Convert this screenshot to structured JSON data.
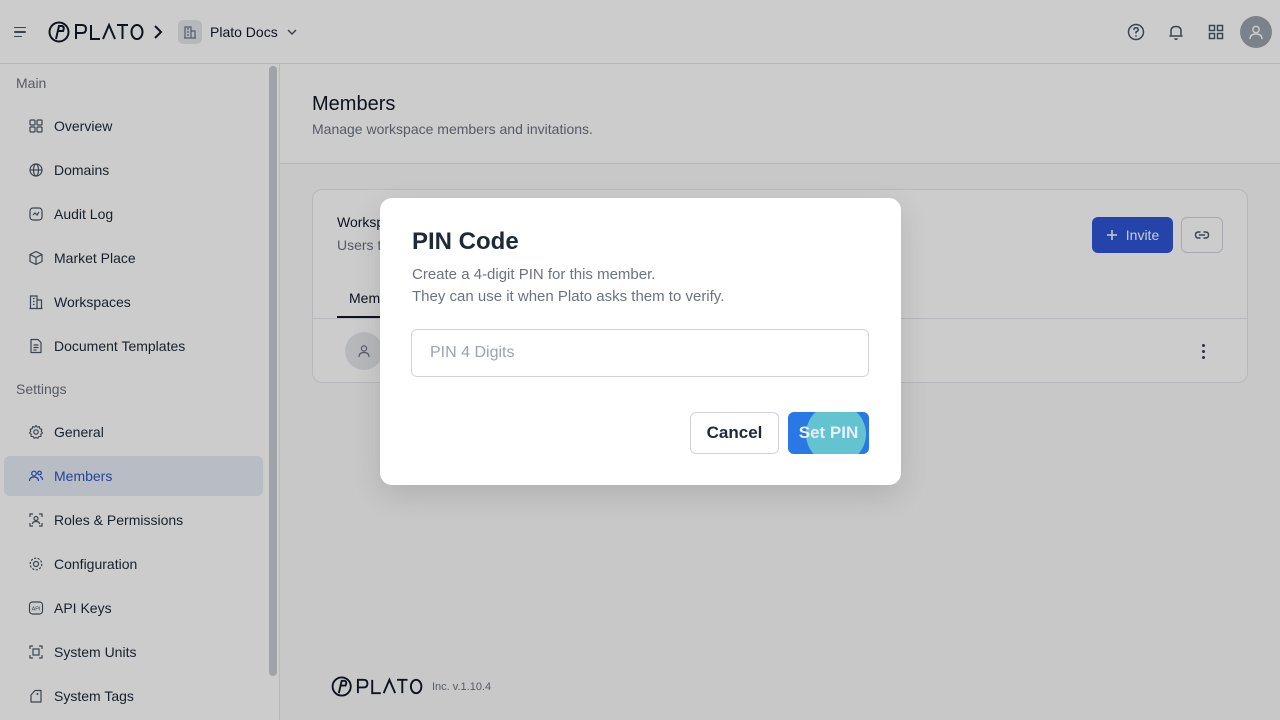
{
  "topbar": {
    "workspace_name": "Plato Docs"
  },
  "sidebar": {
    "sections": [
      {
        "label": "Main"
      },
      {
        "label": "Settings"
      }
    ],
    "items": [
      {
        "label": "Overview",
        "icon": "overview-icon"
      },
      {
        "label": "Domains",
        "icon": "globe-icon"
      },
      {
        "label": "Audit Log",
        "icon": "audit-log-icon"
      },
      {
        "label": "Market Place",
        "icon": "package-icon"
      },
      {
        "label": "Workspaces",
        "icon": "building-icon"
      },
      {
        "label": "Document Templates",
        "icon": "document-icon"
      },
      {
        "label": "General",
        "icon": "gear-icon"
      },
      {
        "label": "Members",
        "icon": "users-icon",
        "active": true
      },
      {
        "label": "Roles & Permissions",
        "icon": "roles-icon"
      },
      {
        "label": "Configuration",
        "icon": "config-icon"
      },
      {
        "label": "API Keys",
        "icon": "api-key-icon"
      },
      {
        "label": "System Units",
        "icon": "units-icon"
      },
      {
        "label": "System Tags",
        "icon": "tag-icon"
      }
    ]
  },
  "page": {
    "title": "Members",
    "subtitle": "Manage workspace members and invitations."
  },
  "card": {
    "title": "Worksp",
    "description": "Users t",
    "tab_label": "Mem",
    "invite_label": "Invite"
  },
  "footer": {
    "version": "Inc. v.1.10.4"
  },
  "modal": {
    "title": "PIN Code",
    "description_line1": "Create a 4-digit PIN for this member.",
    "description_line2": "They can use it when Plato asks them to verify.",
    "pin_placeholder": "PIN 4 Digits",
    "pin_value": "",
    "cancel_label": "Cancel",
    "submit_label": "Set PIN"
  },
  "colors": {
    "primary": "#2f56d6",
    "submit": "#2a77e6",
    "active_nav_bg": "#e6ebf5",
    "active_nav_text": "#2f56c2"
  }
}
